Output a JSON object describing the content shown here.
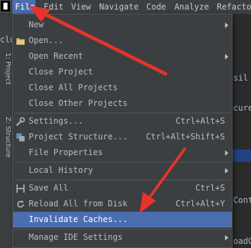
{
  "menubar": {
    "items": [
      {
        "label": "File",
        "active": true
      },
      {
        "label": "Edit"
      },
      {
        "label": "View"
      },
      {
        "label": "Navigate"
      },
      {
        "label": "Code"
      },
      {
        "label": "Analyze"
      },
      {
        "label": "Refactor"
      }
    ]
  },
  "toolstrip": {
    "partial_label": "clo",
    "tab_project": "1: Project",
    "tab_structure": "Z: Structure"
  },
  "editor": {
    "fragment_1": "sil",
    "fragment_2": "cureU",
    "fragment_3": "Cont",
    "fragment_4": "oadC"
  },
  "file_menu": {
    "new": "New",
    "open": "Open...",
    "open_recent": "Open Recent",
    "close_project": "Close Project",
    "close_all_projects": "Close All Projects",
    "close_other_projects": "Close Other Projects",
    "settings": "Settings...",
    "settings_shortcut": "Ctrl+Alt+S",
    "project_structure": "Project Structure...",
    "project_structure_shortcut": "Ctrl+Alt+Shift+S",
    "file_properties": "File Properties",
    "local_history": "Local History",
    "save_all": "Save All",
    "save_all_shortcut": "Ctrl+S",
    "reload_all": "Reload All from Disk",
    "reload_all_shortcut": "Ctrl+Alt+Y",
    "invalidate_caches": "Invalidate Caches...",
    "manage_ide_settings": "Manage IDE Settings"
  },
  "colors": {
    "menu_bg": "#3c3f41",
    "highlight": "#4b6eaf",
    "annotation_arrow": "#e8332a"
  }
}
